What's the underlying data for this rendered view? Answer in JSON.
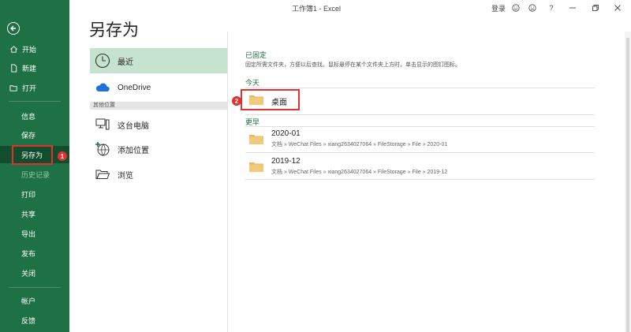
{
  "titlebar": {
    "title": "工作簿1  -  Excel",
    "login": "登录",
    "help": "?"
  },
  "sidebar": {
    "items": [
      {
        "label": "开始",
        "icon": "home-icon"
      },
      {
        "label": "新建",
        "icon": "new-document-icon"
      },
      {
        "label": "打开",
        "icon": "open-folder-icon"
      },
      {
        "label": "信息"
      },
      {
        "label": "保存"
      },
      {
        "label": "另存为"
      },
      {
        "label": "历史记录"
      },
      {
        "label": "打印"
      },
      {
        "label": "共享"
      },
      {
        "label": "导出"
      },
      {
        "label": "发布"
      },
      {
        "label": "关闭"
      },
      {
        "label": "帐户"
      },
      {
        "label": "反馈"
      }
    ],
    "badge": "1"
  },
  "page": {
    "title": "另存为"
  },
  "locations": {
    "recent": "最近",
    "onedrive": "OneDrive",
    "other_header": "其他位置",
    "this_pc": "这台电脑",
    "add_place": "添加位置",
    "browse": "浏览"
  },
  "pinned": {
    "title": "已固定",
    "hint": "固定所需文件夹，方便以后查找。鼠标悬停在某个文件夹上方时，单击显示的图钉图标。"
  },
  "today": {
    "title": "今天",
    "folder": "桌面",
    "badge": "2"
  },
  "earlier": {
    "title": "更早",
    "folders": [
      {
        "name": "2020-01",
        "path": "文档 » WeChat Files » xiang2634027064 » FileStorage » File » 2020-01"
      },
      {
        "name": "2019-12",
        "path": "文档 » WeChat Files » xiang2634027064 » FileStorage » File » 2019-12"
      }
    ]
  },
  "colors": {
    "sidebar": "#1e7145",
    "selected": "#124d2e",
    "accent": "#1e7145",
    "highlight": "#e23131",
    "recent_bg": "#c5e3cf",
    "folder": "#f0c97a"
  }
}
